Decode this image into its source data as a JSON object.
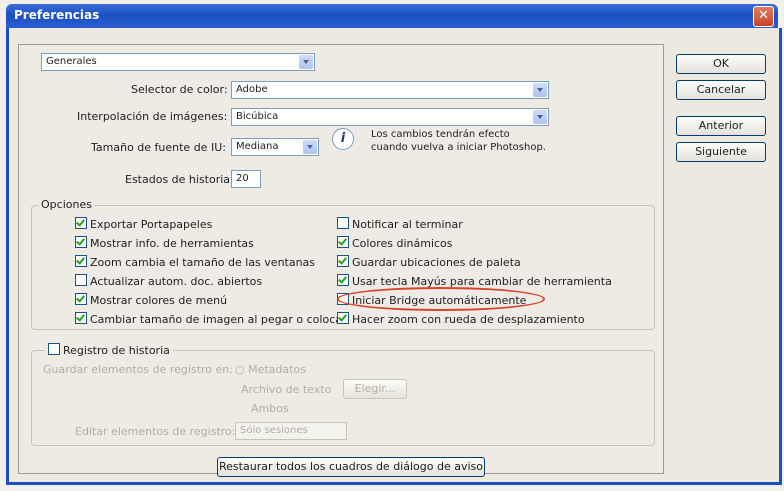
{
  "window": {
    "title": "Preferencias",
    "close_label": "✕"
  },
  "category": {
    "value": "Generales"
  },
  "fields": {
    "color_selector": {
      "label": "Selector de color:",
      "value": "Adobe"
    },
    "interpolation": {
      "label": "Interpolación de imágenes:",
      "value": "Bicúbica"
    },
    "ui_font_size": {
      "label": "Tamaño de fuente de IU:",
      "value": "Mediana"
    },
    "history_states": {
      "label": "Estados de historia:",
      "value": "20"
    }
  },
  "info_note": {
    "line1": "Los cambios tendrán efecto",
    "line2": "cuando vuelva a iniciar Photoshop."
  },
  "buttons": {
    "ok": "OK",
    "cancel": "Cancelar",
    "previous": "Anterior",
    "next": "Siguiente",
    "reset_warnings": "Restaurar todos los cuadros de diálogo de aviso"
  },
  "options": {
    "title": "Opciones",
    "left": [
      {
        "label": "Exportar Portapapeles",
        "checked": true
      },
      {
        "label": "Mostrar info. de herramientas",
        "checked": true
      },
      {
        "label": "Zoom cambia el tamaño de las ventanas",
        "checked": true
      },
      {
        "label": "Actualizar autom. doc. abiertos",
        "checked": false
      },
      {
        "label": "Mostrar colores de menú",
        "checked": true
      },
      {
        "label": "Cambiar tamaño de imagen al pegar o colocar",
        "checked": true
      }
    ],
    "right": [
      {
        "label": "Notificar al terminar",
        "checked": false
      },
      {
        "label": "Colores dinámicos",
        "checked": true
      },
      {
        "label": "Guardar ubicaciones de paleta",
        "checked": true
      },
      {
        "label": "Usar tecla Mayús para cambiar de herramienta",
        "checked": true
      },
      {
        "label": "Iniciar Bridge automáticamente",
        "checked": false
      },
      {
        "label": "Hacer zoom con rueda de desplazamiento",
        "checked": true
      }
    ]
  },
  "history_log": {
    "title": "Registro de historia",
    "checked": false,
    "save_label": "Guardar elementos de registro en:",
    "metadata": "Metadatos",
    "text_file": "Archivo de texto",
    "choose": "Elegir...",
    "both": "Ambos",
    "edit_label": "Editar elementos de registro:",
    "edit_value": "Sólo sesiones"
  },
  "colors": {
    "title_bar": "#1c4fc2",
    "highlight": "#d8432f",
    "check": "#21a121"
  }
}
